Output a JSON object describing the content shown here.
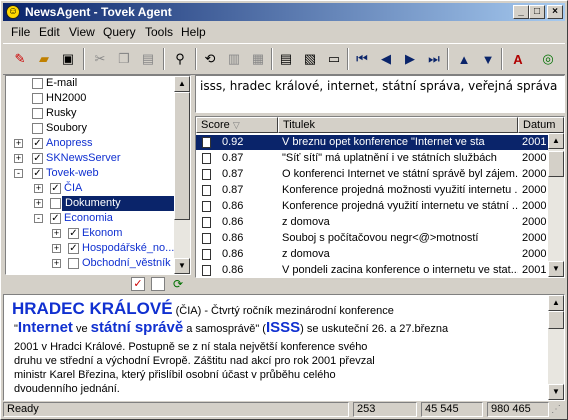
{
  "window": {
    "title": "NewsAgent - Tovek Agent",
    "controls": {
      "minimize": "_",
      "maximize": "□",
      "close": "×"
    }
  },
  "menu": [
    "File",
    "Edit",
    "View",
    "Query",
    "Tools",
    "Help"
  ],
  "toolbar_icons": [
    "new-icon",
    "open-icon",
    "save-icon",
    "cut-icon",
    "copy-icon",
    "paste-icon",
    "find-icon",
    "refresh-icon",
    "filter-icon",
    "stats-icon",
    "document-icon",
    "document-view-icon",
    "preview-icon",
    "first-icon",
    "previous-icon",
    "next-icon",
    "last-icon",
    "up-icon",
    "down-icon",
    "font-icon",
    "globe-icon"
  ],
  "tree": {
    "items": [
      {
        "label": "E-mail",
        "checked": false,
        "expander": ""
      },
      {
        "label": "HN2000",
        "checked": false,
        "expander": ""
      },
      {
        "label": "Rusky",
        "checked": false,
        "expander": ""
      },
      {
        "label": "Soubory",
        "checked": false,
        "expander": ""
      },
      {
        "label": "Anopress",
        "checked": true,
        "expander": "+"
      },
      {
        "label": "SKNewsServer",
        "checked": true,
        "expander": "+"
      },
      {
        "label": "Tovek-web",
        "checked": true,
        "expander": "-"
      },
      {
        "label": "ČIA",
        "checked": true,
        "expander": "+"
      },
      {
        "label": "Dokumenty",
        "checked": false,
        "expander": "+"
      },
      {
        "label": "Economia",
        "checked": true,
        "expander": "-"
      },
      {
        "label": "Ekonom",
        "checked": true,
        "expander": "+"
      },
      {
        "label": "Hospodářské_no...",
        "checked": true,
        "expander": "+"
      },
      {
        "label": "Obchodní_věstník",
        "checked": false,
        "expander": "+"
      }
    ]
  },
  "query": {
    "text": "isss, hradec králové, internet, státní správa, veřejná správa"
  },
  "results": {
    "columns": [
      "Score",
      "Titulek",
      "Datum"
    ],
    "rows": [
      {
        "score": "0.92",
        "title": "V breznu opet konference \"Internet ve sta",
        "date": "2001"
      },
      {
        "score": "0.87",
        "title": "\"Síť sítí\" má uplatnění i ve státních službách",
        "date": "2000"
      },
      {
        "score": "0.87",
        "title": "O konferenci Internet ve státní správě byl zájem...",
        "date": "2000"
      },
      {
        "score": "0.87",
        "title": "Konference projedná možnosti využití internetu ...",
        "date": "2000"
      },
      {
        "score": "0.86",
        "title": "Konference projedná využití internetu ve státní ...",
        "date": "2000"
      },
      {
        "score": "0.86",
        "title": "z domova",
        "date": "2000"
      },
      {
        "score": "0.86",
        "title": "Souboj s počítačovou negr<@>motností",
        "date": "2000"
      },
      {
        "score": "0.86",
        "title": "z domova",
        "date": "2000"
      },
      {
        "score": "0.86",
        "title": "V pondeli zacina konference o internetu ve stat...",
        "date": "2001"
      }
    ]
  },
  "preview": {
    "heading_big": "HRADEC KRÁLOVÉ",
    "heading_rest": " (ČIA) - Čtvrtý ročník mezinárodní konference",
    "q_open": "\"",
    "w_internet": "Internet",
    "t_ve": " ve ",
    "w_statni": "státní správě",
    "t_a": " a samosprávě\" (",
    "w_isss": "ISSS",
    "t_rest": ") se uskuteční 26. a 27.března",
    "line3": "2001 v Hradci Králové. Postupně se z ní stala největší konference svého",
    "line4": "druhu ve střední a východní Evropě. Záštitu nad akcí pro rok 2001 převzal",
    "line5": "ministr Karel Březina, který přislíbil osobní účast v průběhu celého",
    "line6": "dvoudenního jednání."
  },
  "status": {
    "text": "Ready",
    "count": "253",
    "num1": "45 545",
    "num2": "980 465"
  },
  "colors": {
    "link_blue": "#1030d0",
    "selection": "#0a246a",
    "title_start": "#0a246a"
  }
}
